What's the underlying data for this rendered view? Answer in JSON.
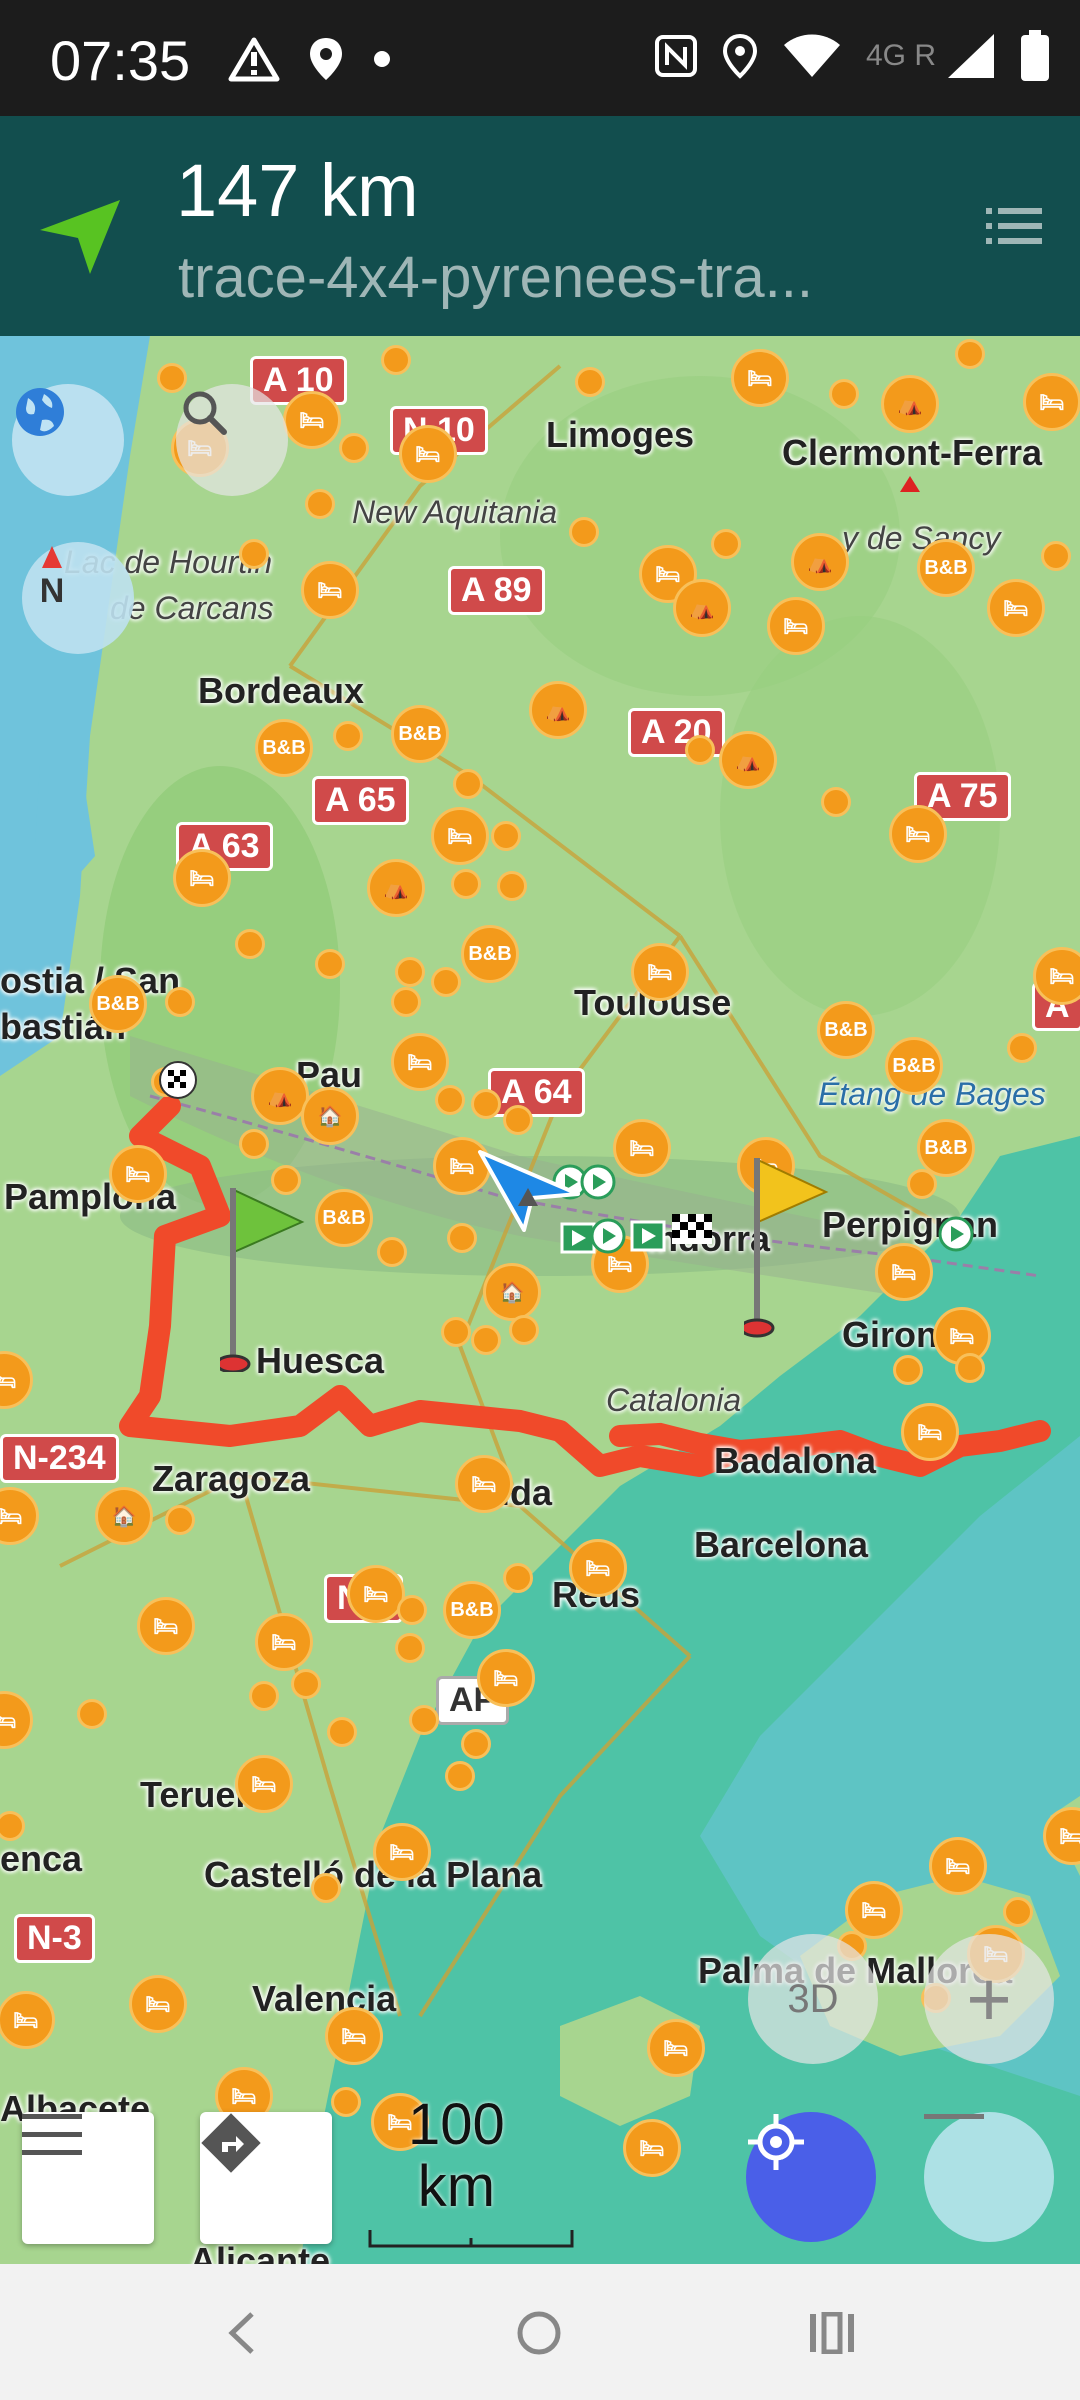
{
  "status_bar": {
    "time": "07:35",
    "left_icons": [
      "warning-icon",
      "location-pin-icon",
      "dot-icon"
    ],
    "right_icons": [
      "nfc-icon",
      "location-icon",
      "wifi-icon",
      "signal-icon",
      "battery-icon"
    ],
    "network_type": "4G R"
  },
  "header": {
    "distance": "147 km",
    "track_name": "trace-4x4-pyrenees-tra..."
  },
  "map": {
    "places": [
      {
        "name": "Limoges"
      },
      {
        "name": "Clermont-Ferra"
      },
      {
        "name": "Bordeaux"
      },
      {
        "name": "Toulouse"
      },
      {
        "name": "Pau"
      },
      {
        "name": "Pamplona"
      },
      {
        "name": "Perpignan"
      },
      {
        "name": "Huesca"
      },
      {
        "name": "Giron"
      },
      {
        "name": "Zaragoza"
      },
      {
        "name": "Badalona"
      },
      {
        "name": "Barcelona"
      },
      {
        "name": "Reus"
      },
      {
        "name": "Teruel"
      },
      {
        "name": "Castelló de la Plana"
      },
      {
        "name": "Valencia"
      },
      {
        "name": "Palma de Mallorca"
      },
      {
        "name": "Alicante"
      },
      {
        "name": "Albacete"
      },
      {
        "name": "enca"
      },
      {
        "name": "ostia / San"
      },
      {
        "name": "bastián"
      },
      {
        "name": "ida"
      },
      {
        "name": "Andorra"
      }
    ],
    "regions": [
      "New Aquitania",
      "Catalonia",
      "Lac de Hourtin",
      "de Carcans",
      "Étang de Bages",
      "y de Sancy"
    ],
    "roads": [
      "A 10",
      "N 10",
      "A 89",
      "A 20",
      "A 65",
      "A 63",
      "A 75",
      "A 64",
      "N-234",
      "N 2",
      "AP",
      "N-3",
      "A"
    ],
    "scale_label": "100\nkm"
  },
  "controls": {
    "globe": "globe-icon",
    "search": "search-icon",
    "compass": "N",
    "btn_3d": "3D",
    "zoom_in": "+",
    "zoom_out": "—",
    "menu": "menu-icon",
    "directions": "directions-icon",
    "my_location": "my-location-icon"
  },
  "colors": {
    "header_bg": "#124e4e",
    "route": "#f04a2a",
    "poi": "#f39a1b",
    "location_button": "#4a5fe8"
  }
}
